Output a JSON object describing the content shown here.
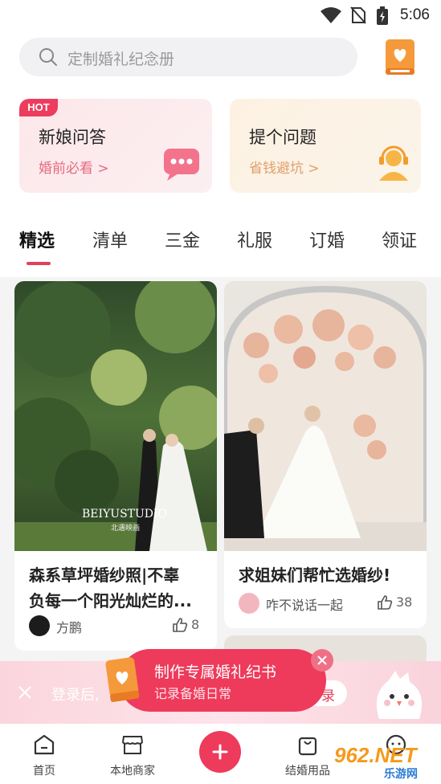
{
  "status_bar": {
    "time": "5:06"
  },
  "search": {
    "placeholder": "定制婚礼纪念册"
  },
  "cards": [
    {
      "badge": "HOT",
      "title": "新娘问答",
      "subtitle": "婚前必看 >"
    },
    {
      "title": "提个问题",
      "subtitle": "省钱避坑 >"
    }
  ],
  "tabs": [
    "精选",
    "清单",
    "三金",
    "礼服",
    "订婚",
    "领证"
  ],
  "active_tab": 0,
  "posts": [
    {
      "image_caption": "BEIYUSTUDIO",
      "image_caption_sub": "北遇映画",
      "title_line1": "森系草坪婚纱照|不辜",
      "title_line2": "负每一个阳光灿烂的...",
      "author": "方鹏",
      "likes": "8"
    },
    {
      "title_line1": "求姐妹们帮忙选婚纱!",
      "author": "咋不说话一起",
      "likes": "38"
    }
  ],
  "banner": {
    "text": "登录后,",
    "login_fragment": "录"
  },
  "popup": {
    "title": "制作专属婚礼纪书",
    "subtitle": "记录备婚日常"
  },
  "bottom_nav": [
    {
      "label": "首页",
      "icon": "home-icon"
    },
    {
      "label": "本地商家",
      "icon": "store-icon"
    },
    {
      "label": "",
      "icon": "add-icon"
    },
    {
      "label": "结婚用品",
      "icon": "bag-icon"
    },
    {
      "label": "",
      "icon": "profile-icon"
    }
  ],
  "watermark": {
    "line1": "962.NET",
    "line2": "乐游网"
  },
  "colors": {
    "accent": "#ee3a5b",
    "indicator": "#e3405a",
    "card_qa_bg": "#fde7ea",
    "card_ask_bg": "#fdf1e2"
  }
}
